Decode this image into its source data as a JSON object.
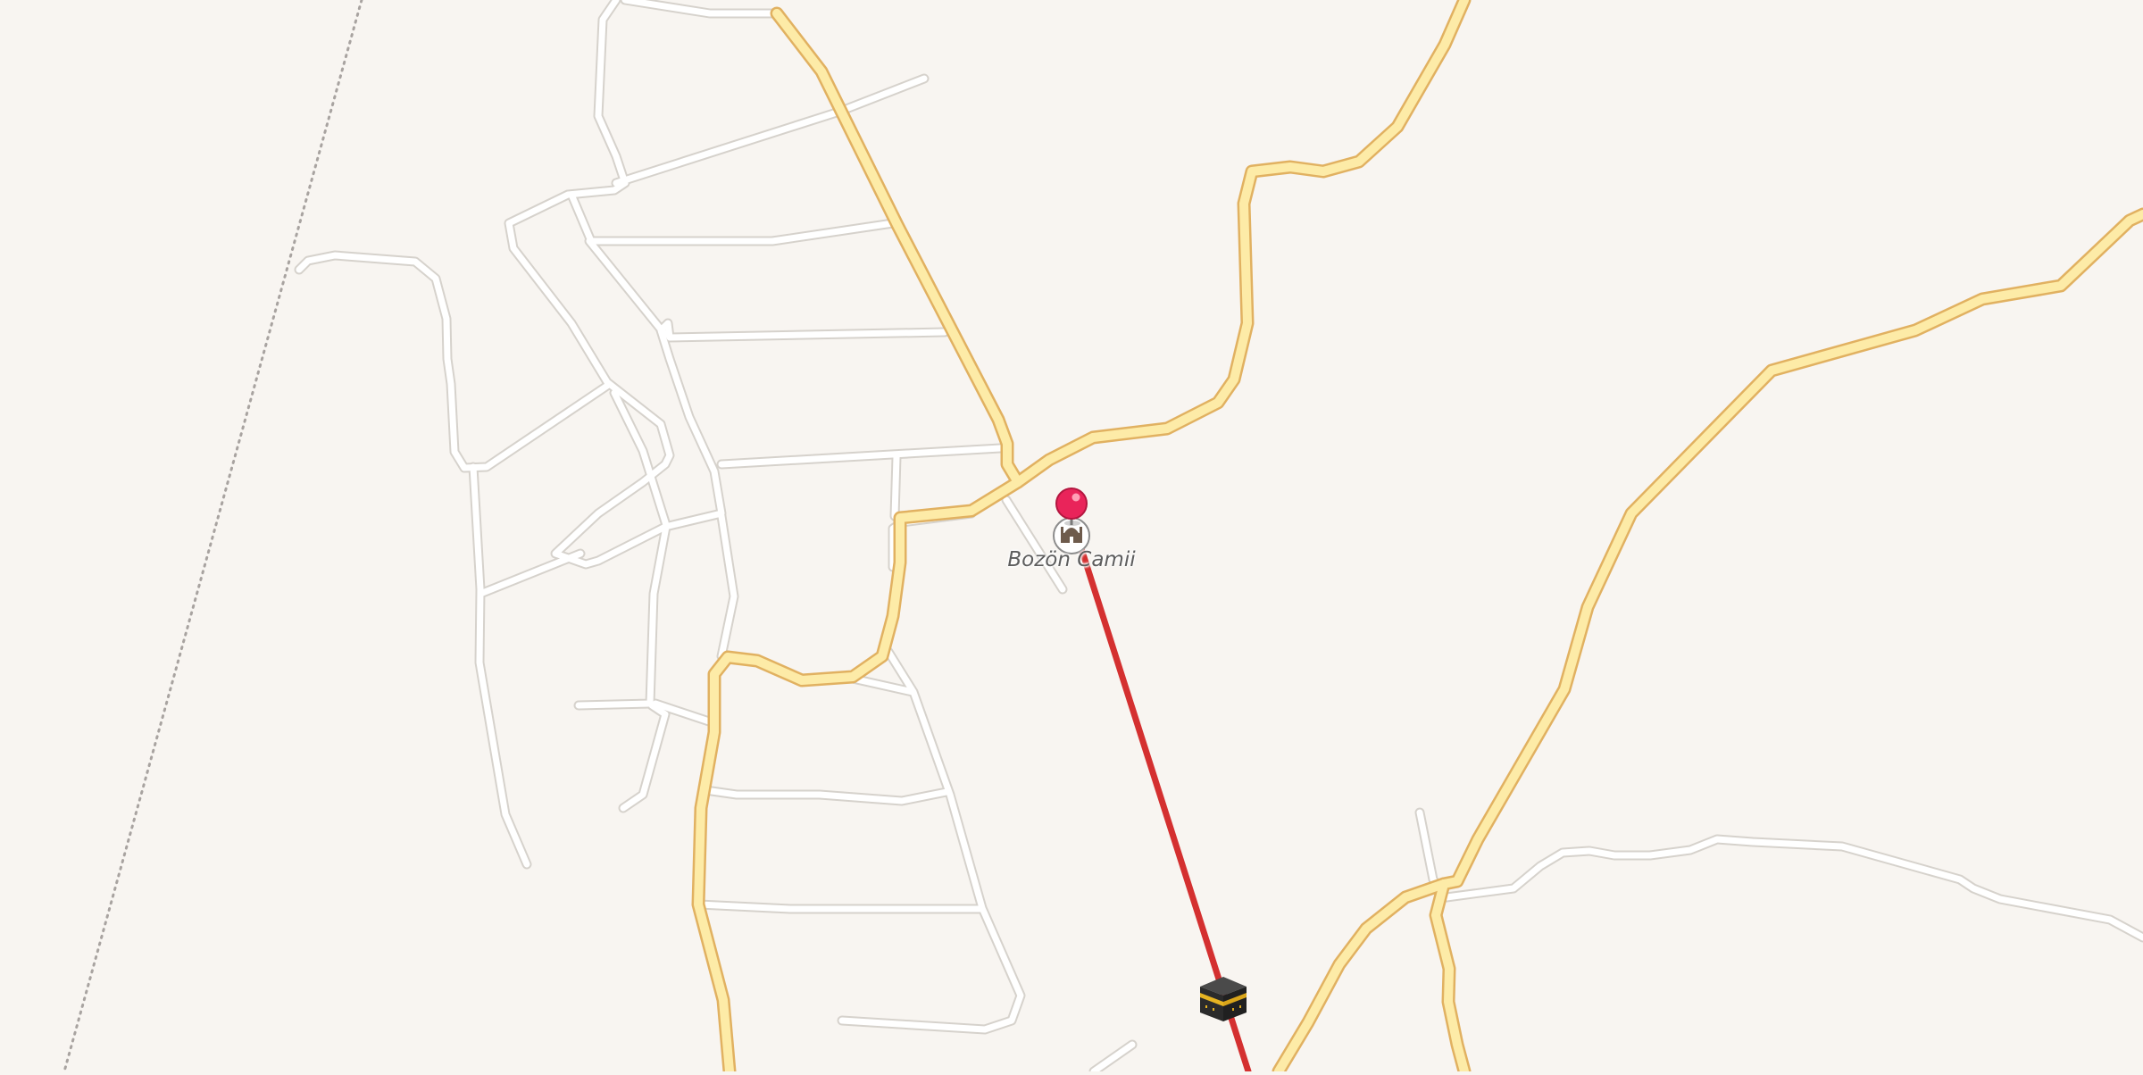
{
  "map": {
    "poi": {
      "label": "Bozön Camii",
      "icon": "mosque-icon"
    },
    "markers": [
      {
        "name": "location-pin-icon",
        "color": "#e9245a"
      },
      {
        "name": "kaaba-icon"
      }
    ],
    "qibla_line": {
      "color": "#d43030"
    },
    "colors": {
      "background": "#f8f5f1",
      "main_road": "#fdeba7",
      "main_road_casing": "#e1b161",
      "street": "#ffffff",
      "street_casing": "#d6d2cc",
      "boundary": "#a8a3a0"
    }
  }
}
